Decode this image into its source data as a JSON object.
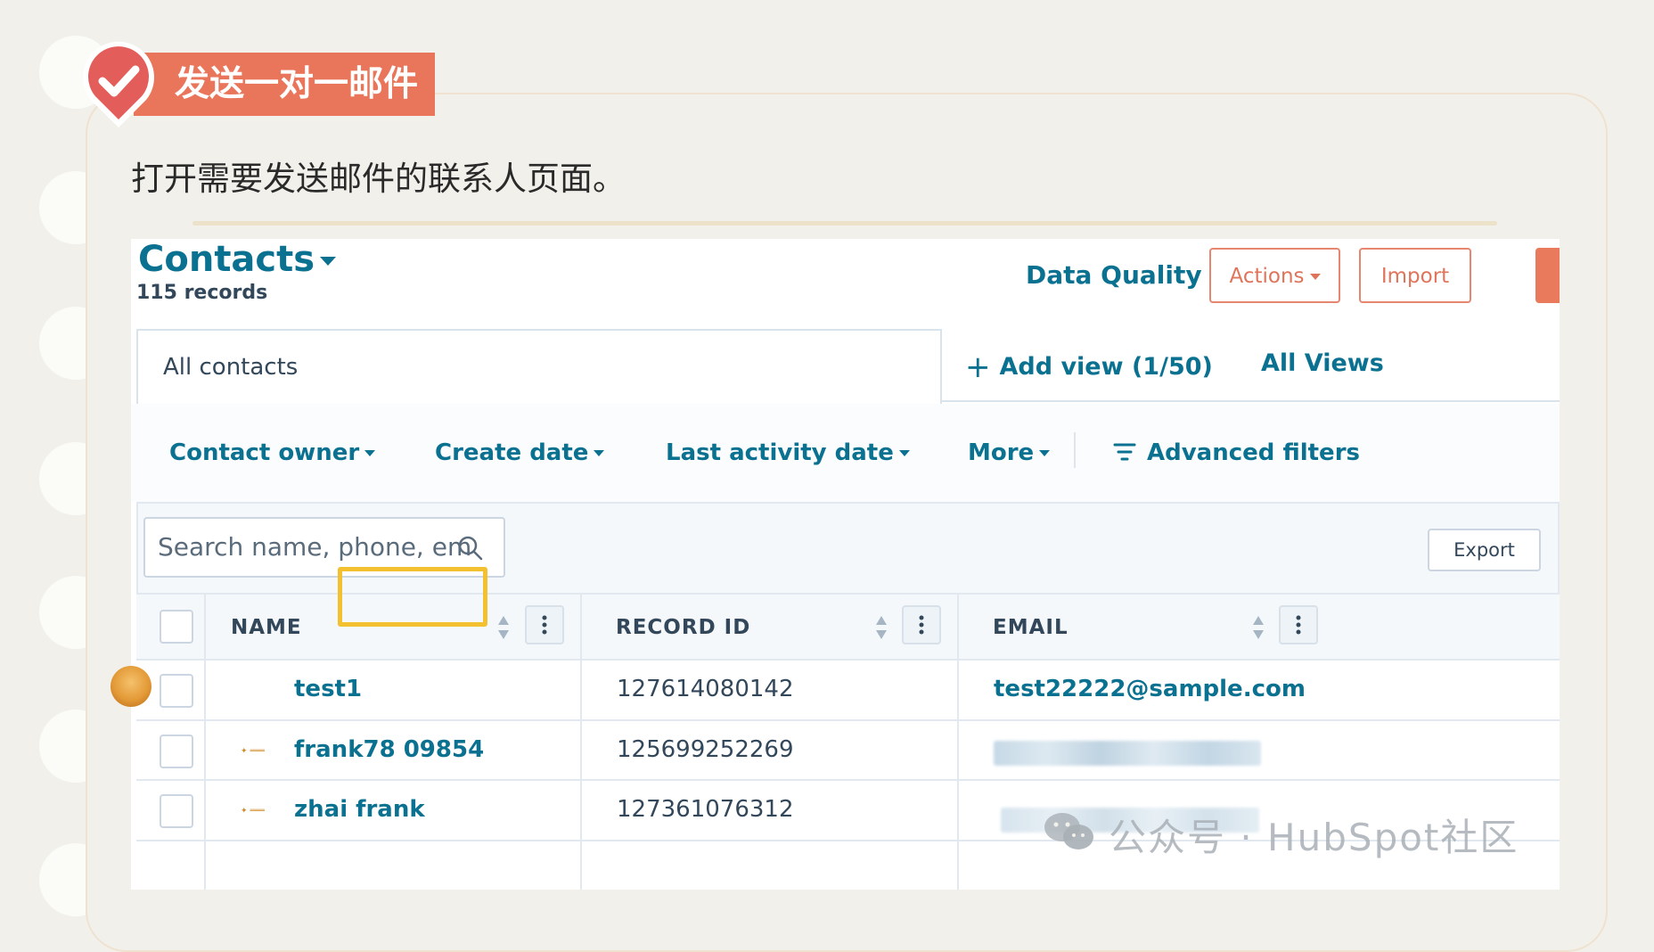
{
  "section": {
    "title": "发送一对一邮件",
    "intro": "打开需要发送邮件的联系人页面。"
  },
  "crm": {
    "header": {
      "title": "Contacts",
      "records": "115 records",
      "data_quality": "Data Quality",
      "actions": "Actions",
      "import": "Import"
    },
    "views": {
      "current": "All contacts",
      "add_view": "Add view (1/50)",
      "all_views": "All Views"
    },
    "filters": {
      "contact_owner": "Contact owner",
      "create_date": "Create date",
      "last_activity_date": "Last activity date",
      "more": "More",
      "advanced": "Advanced filters"
    },
    "toolbar": {
      "search_placeholder": "Search name, phone, em",
      "export": "Export"
    },
    "table": {
      "columns": [
        "NAME",
        "RECORD ID",
        "EMAIL"
      ],
      "rows": [
        {
          "name": "test1",
          "record_id": "127614080142",
          "email": "test22222@sample.com"
        },
        {
          "name": "frank78 09854",
          "record_id": "125699252269",
          "email": ""
        },
        {
          "name": "zhai frank",
          "record_id": "127361076312",
          "email": ""
        }
      ]
    }
  },
  "watermark": "公众号 · HubSpot社区",
  "colors": {
    "accent": "#e9765b",
    "teal": "#0b7191",
    "highlight": "#f3c12f"
  },
  "icons": [
    "check-badge-icon",
    "plus-icon",
    "filter-lines-icon",
    "search-icon",
    "sort-icon",
    "kebab-menu-icon",
    "wechat-icon"
  ]
}
